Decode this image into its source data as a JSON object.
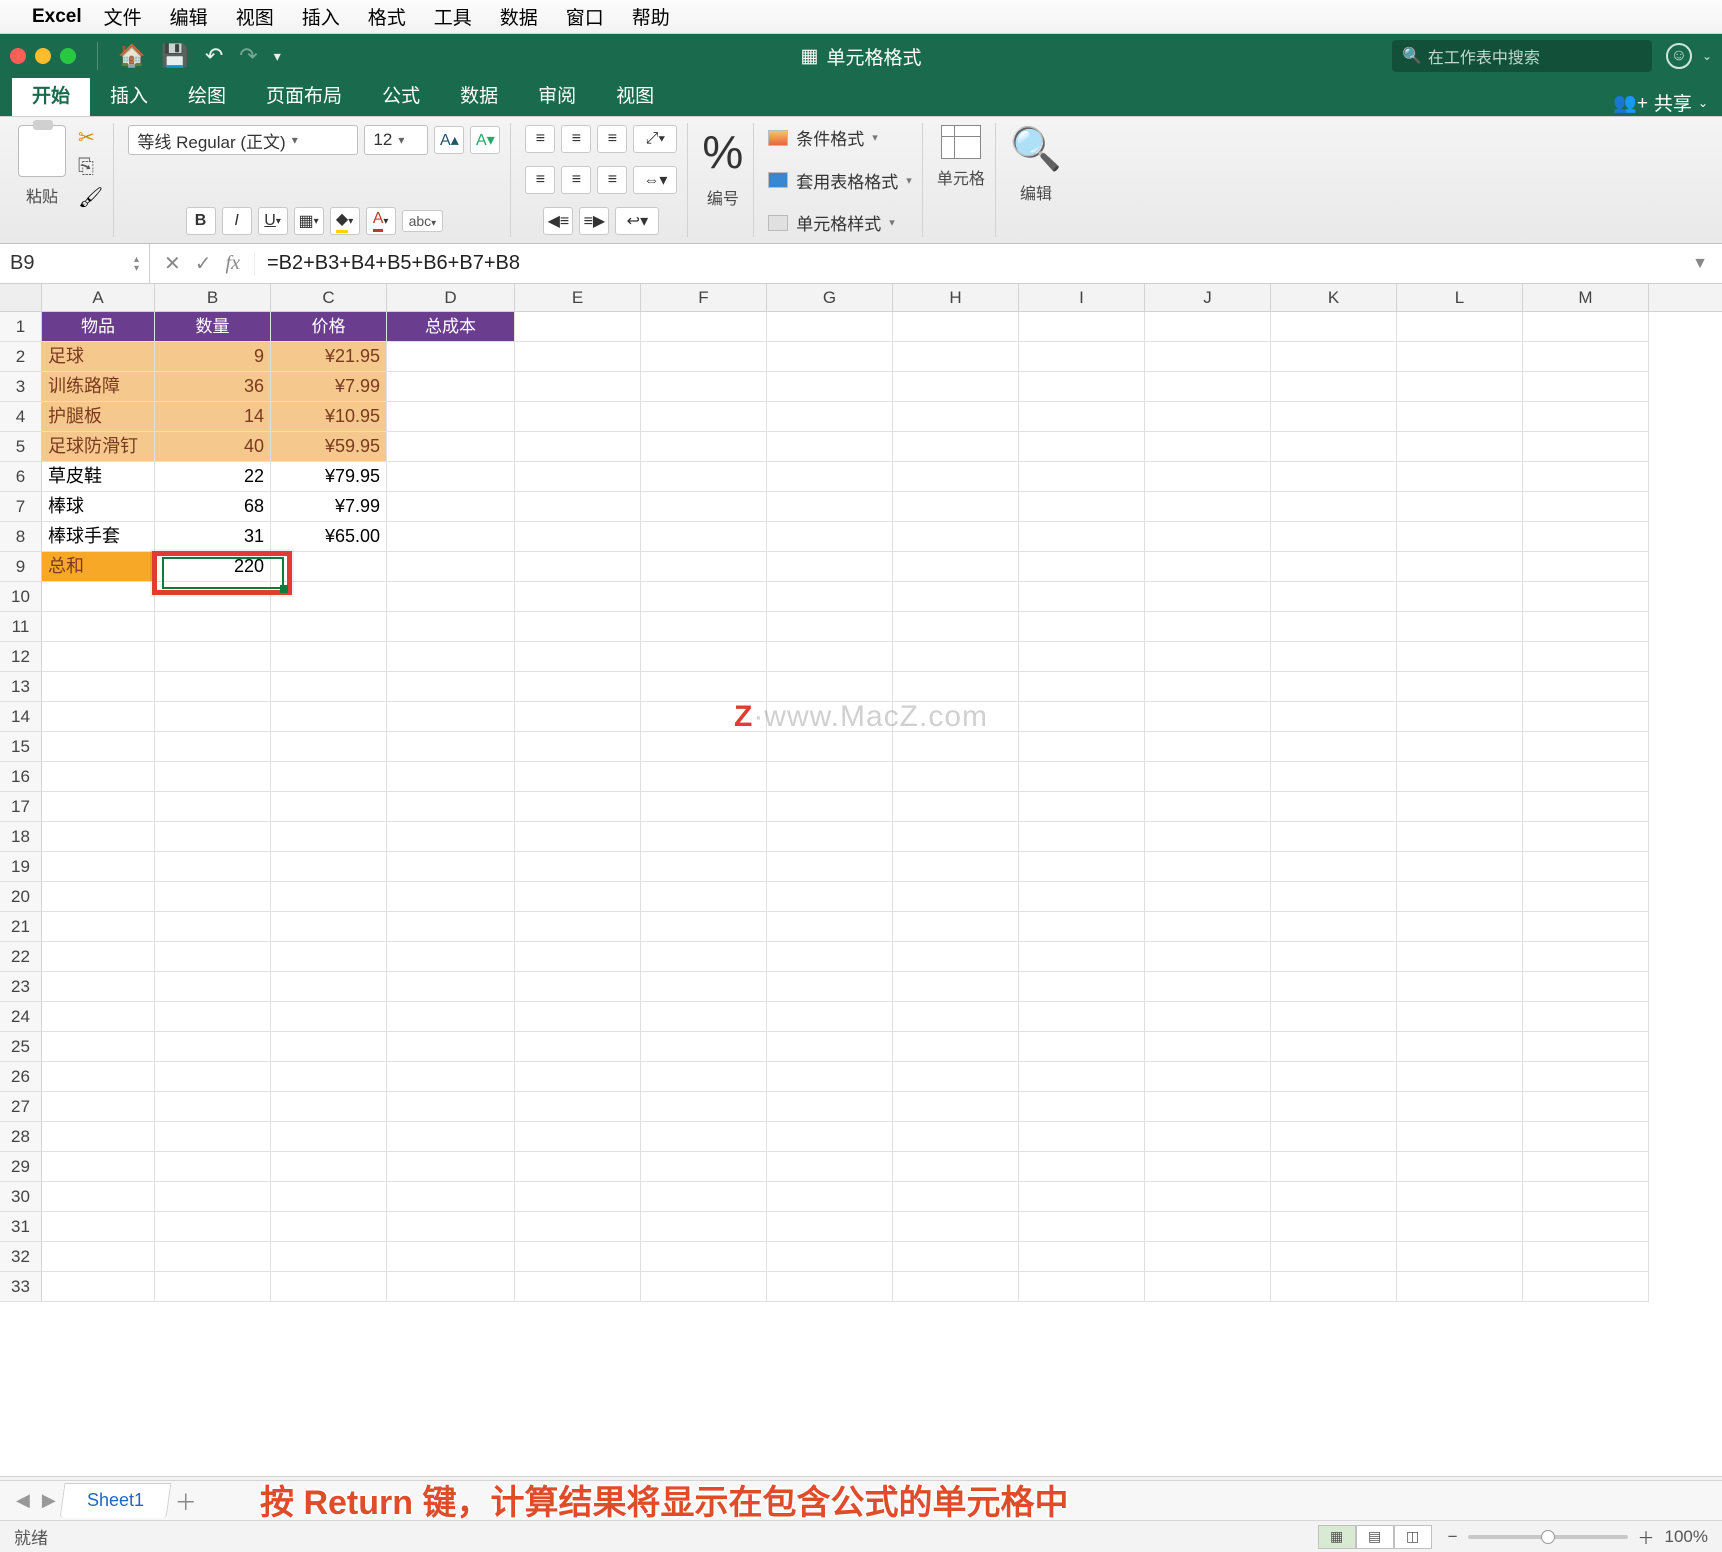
{
  "menubar": {
    "app": "Excel",
    "items": [
      "文件",
      "编辑",
      "视图",
      "插入",
      "格式",
      "工具",
      "数据",
      "窗口",
      "帮助"
    ]
  },
  "titlebar": {
    "doc": "单元格格式",
    "search_ph": "在工作表中搜索"
  },
  "tabs": {
    "active": "开始",
    "items": [
      "开始",
      "插入",
      "绘图",
      "页面布局",
      "公式",
      "数据",
      "审阅",
      "视图"
    ],
    "share": "共享"
  },
  "ribbon": {
    "paste": "粘贴",
    "font_name": "等线 Regular (正文)",
    "font_size": "12",
    "cond1": "条件格式",
    "cond2": "套用表格格式",
    "cond3": "单元格样式",
    "number": "编号",
    "cells": "单元格",
    "editing": "编辑"
  },
  "fx": {
    "name": "B9",
    "formula": "=B2+B3+B4+B5+B6+B7+B8"
  },
  "columns": [
    "A",
    "B",
    "C",
    "D",
    "E",
    "F",
    "G",
    "H",
    "I",
    "J",
    "K",
    "L",
    "M"
  ],
  "rows_total": 33,
  "headers": {
    "a": "物品",
    "b": "数量",
    "c": "价格",
    "d": "总成本"
  },
  "data": [
    {
      "a": "足球",
      "b": "9",
      "c": "¥21.95",
      "hl": true
    },
    {
      "a": "训练路障",
      "b": "36",
      "c": "¥7.99",
      "hl": true
    },
    {
      "a": "护腿板",
      "b": "14",
      "c": "¥10.95",
      "hl": true
    },
    {
      "a": "足球防滑钉",
      "b": "40",
      "c": "¥59.95",
      "hl": true
    },
    {
      "a": "草皮鞋",
      "b": "22",
      "c": "¥79.95",
      "hl": false
    },
    {
      "a": "棒球",
      "b": "68",
      "c": "¥7.99",
      "hl": false
    },
    {
      "a": "棒球手套",
      "b": "31",
      "c": "¥65.00",
      "hl": false
    }
  ],
  "sum": {
    "label": "总和",
    "value": "220"
  },
  "sheet": {
    "name": "Sheet1"
  },
  "status": {
    "ready": "就绪",
    "zoom": "100%"
  },
  "overlay": "按 Return 键，计算结果将显示在包含公式的单元格中",
  "watermark": {
    "z": "Z",
    "rest": "·www.MacZ.com"
  }
}
